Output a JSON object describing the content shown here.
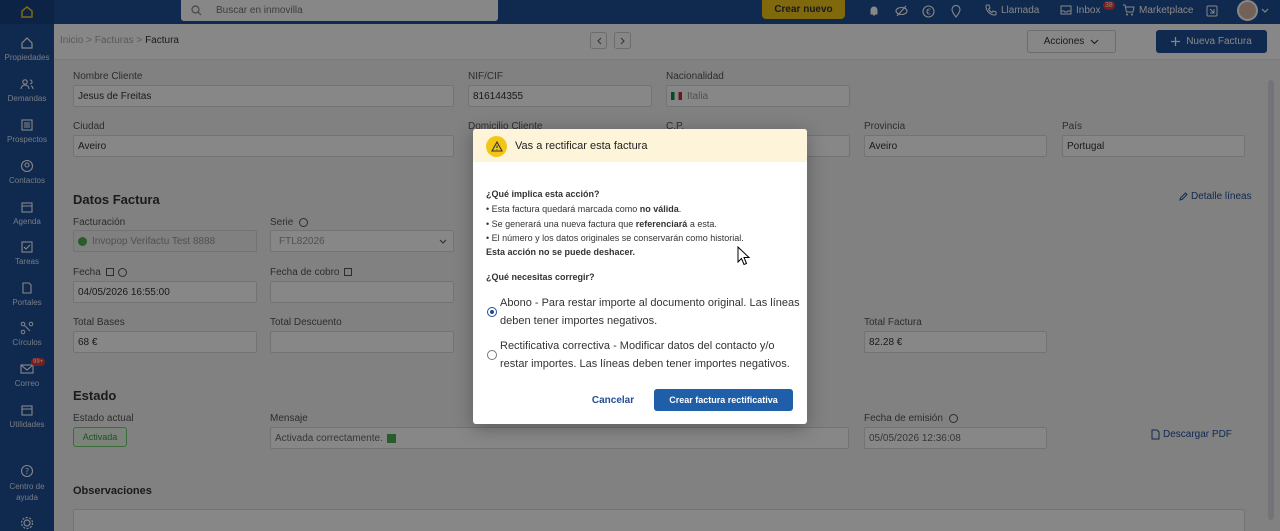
{
  "topbar": {
    "search_placeholder": "Buscar en inmovilla",
    "crear_nuevo": "Crear nuevo",
    "llamada": "Llamada",
    "inbox": "Inbox",
    "inbox_count": "38",
    "marketplace": "Marketplace"
  },
  "sidebar": {
    "items": [
      {
        "label": "Propiedades",
        "icon": "home-icon"
      },
      {
        "label": "Demandas",
        "icon": "people-icon"
      },
      {
        "label": "Prospectos",
        "icon": "list-icon"
      },
      {
        "label": "Contactos",
        "icon": "contact-icon"
      },
      {
        "label": "Agenda",
        "icon": "calendar-icon"
      },
      {
        "label": "Tareas",
        "icon": "tasks-icon"
      },
      {
        "label": "Portales",
        "icon": "portals-icon"
      },
      {
        "label": "Círculos",
        "icon": "circles-icon"
      },
      {
        "label": "Correo",
        "icon": "mail-icon"
      },
      {
        "label": "Utilidades",
        "icon": "tools-icon"
      },
      {
        "label": "Centro de ayuda",
        "icon": "help-icon"
      }
    ],
    "correo_badge": "99+"
  },
  "breadcrumb": {
    "prev1": "Inicio",
    "prev2": "Facturas",
    "current": "Factura"
  },
  "actions": {
    "acciones": "Acciones",
    "nueva_factura": "Nueva Factura"
  },
  "cliente": {
    "nombre_label": "Nombre Cliente",
    "nombre_value": "Jesus de Freitas",
    "nif_label": "NIF/CIF",
    "nif_value": "816144355",
    "nacionalidad_label": "Nacionalidad",
    "nacionalidad_value": "Italia",
    "ciudad_label": "Ciudad",
    "ciudad_value": "Aveiro",
    "domicilio_label": "Domicilio Cliente",
    "cp_label": "C.P.",
    "provincia_label": "Provincia",
    "provincia_value": "Aveiro",
    "pais_label": "País",
    "pais_value": "Portugal"
  },
  "datos_factura": {
    "title": "Datos Factura",
    "detalle_lineas": "Detalle líneas",
    "facturacion_label": "Facturación",
    "facturacion_value": "Invopop Verifactu Test 8888",
    "serie_label": "Serie",
    "serie_value": "FTL82026",
    "fecha_label": "Fecha",
    "fecha_value": "04/05/2026 16:55:00",
    "fecha_cobro_label": "Fecha de cobro",
    "total_bases_label": "Total Bases",
    "total_bases_value": "68 €",
    "total_descuento_label": "Total Descuento",
    "total_factura_label": "Total Factura",
    "total_factura_value": "82.28 €"
  },
  "estado": {
    "title": "Estado",
    "estado_actual_label": "Estado actual",
    "estado_actual_value": "Activada",
    "mensaje_label": "Mensaje",
    "mensaje_value": "Activada correctamente.",
    "fecha_emision_label": "Fecha de emisión",
    "fecha_emision_value": "05/05/2026 12:36:08",
    "descargar_pdf": "Descargar PDF"
  },
  "observaciones": {
    "title": "Observaciones"
  },
  "modal": {
    "title": "Vas a rectificar esta factura",
    "question1": "¿Qué implica esta acción?",
    "bullet1_pre": "Esta factura quedará marcada como ",
    "bullet1_bold": "no válida",
    "bullet1_post": ".",
    "bullet2_pre": "Se generará una nueva factura que ",
    "bullet2_bold": "referenciará",
    "bullet2_post": " a esta.",
    "bullet3": "El número y los datos originales se conservarán como historial.",
    "warning": "Esta acción no se puede deshacer.",
    "question2": "¿Qué necesitas corregir?",
    "option1": "Abono - Para restar importe al documento original. Las líneas deben tener importes negativos.",
    "option2": "Rectificativa correctiva - Modificar datos del contacto y/o restar importes. Las líneas deben tener importes negativos.",
    "cancel": "Cancelar",
    "create": "Crear factura rectificativa"
  },
  "colors": {
    "brand": "#1f4e95",
    "accent": "#f2c619",
    "warning_bg": "#fdf4d9"
  }
}
